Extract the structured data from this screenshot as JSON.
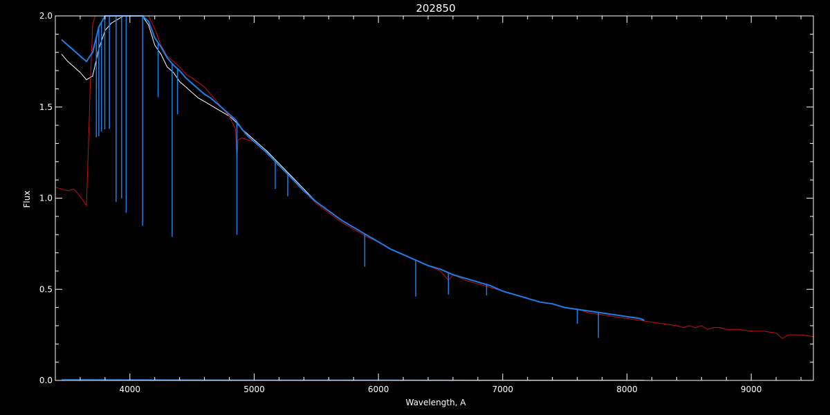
{
  "chart_data": {
    "type": "line",
    "title": "202850",
    "xlabel": "Wavelength, A",
    "ylabel": "Flux",
    "xlim": [
      3400,
      9500
    ],
    "ylim": [
      0.0,
      2.0
    ],
    "x_ticks": [
      4000,
      5000,
      6000,
      7000,
      8000,
      9000
    ],
    "x_tick_labels": [
      "4000",
      "5000",
      "6000",
      "7000",
      "8000",
      "9000"
    ],
    "y_ticks": [
      0.0,
      0.5,
      1.0,
      1.5,
      2.0
    ],
    "y_tick_labels": [
      "0.0",
      "0.5",
      "1.0",
      "1.5",
      "2.0"
    ],
    "grid": false,
    "background": "#000000",
    "series": [
      {
        "color": "#ffffff",
        "x": [
          3450,
          3500,
          3550,
          3600,
          3650,
          3700,
          3750,
          3800,
          3850,
          3900,
          3950,
          4000,
          4050,
          4100,
          4150,
          4200,
          4250,
          4300,
          4350,
          4400,
          4450,
          4500,
          4550,
          4600,
          4650,
          4700,
          4750,
          4800,
          4850,
          4900,
          4950,
          5000,
          5100,
          5200,
          5300,
          5400,
          5500,
          5600,
          5700,
          5800,
          5900,
          6000,
          6100,
          6200,
          6300,
          6400,
          6500,
          6600,
          6700,
          6800,
          6900,
          7000,
          7100,
          7200,
          7300,
          7400,
          7500,
          7600,
          7700,
          7800,
          7900,
          8000,
          8100,
          8140
        ],
        "y": [
          1.79,
          1.75,
          1.72,
          1.69,
          1.65,
          1.67,
          1.82,
          1.92,
          1.96,
          1.98,
          2.0,
          2.0,
          2.0,
          2.0,
          1.95,
          1.84,
          1.79,
          1.72,
          1.69,
          1.64,
          1.61,
          1.58,
          1.55,
          1.53,
          1.51,
          1.49,
          1.47,
          1.45,
          1.42,
          1.38,
          1.35,
          1.32,
          1.26,
          1.19,
          1.12,
          1.05,
          0.98,
          0.93,
          0.88,
          0.84,
          0.8,
          0.76,
          0.72,
          0.69,
          0.66,
          0.63,
          0.61,
          0.58,
          0.56,
          0.54,
          0.52,
          0.49,
          0.47,
          0.45,
          0.43,
          0.42,
          0.4,
          0.39,
          0.38,
          0.37,
          0.36,
          0.35,
          0.34,
          0.33
        ]
      },
      {
        "color": "#cc1010",
        "x": [
          3400,
          3450,
          3500,
          3550,
          3600,
          3630,
          3650,
          3660,
          3680,
          3700,
          3720,
          3750,
          3800,
          3850,
          3900,
          3950,
          4000,
          4050,
          4100,
          4150,
          4200,
          4250,
          4300,
          4350,
          4400,
          4450,
          4500,
          4600,
          4700,
          4800,
          4850,
          4861,
          4870,
          4900,
          5000,
          5100,
          5200,
          5300,
          5400,
          5500,
          5600,
          5700,
          5800,
          5900,
          6000,
          6100,
          6200,
          6300,
          6400,
          6500,
          6563,
          6600,
          6700,
          6800,
          6900,
          7000,
          7100,
          7200,
          7300,
          7400,
          7500,
          7600,
          7700,
          7800,
          7900,
          8000,
          8100,
          8200,
          8300,
          8400,
          8450,
          8500,
          8550,
          8600,
          8650,
          8700,
          8750,
          8800,
          8900,
          9000,
          9100,
          9200,
          9250,
          9300,
          9400,
          9500
        ],
        "y": [
          1.06,
          1.05,
          1.04,
          1.05,
          1.01,
          0.98,
          0.96,
          1.15,
          1.6,
          1.95,
          2.0,
          2.0,
          2.0,
          2.0,
          2.0,
          2.0,
          2.0,
          2.0,
          2.0,
          2.0,
          1.93,
          1.84,
          1.78,
          1.75,
          1.72,
          1.68,
          1.66,
          1.61,
          1.53,
          1.45,
          1.38,
          1.2,
          1.32,
          1.33,
          1.31,
          1.25,
          1.18,
          1.11,
          1.04,
          0.97,
          0.92,
          0.87,
          0.83,
          0.79,
          0.76,
          0.72,
          0.69,
          0.66,
          0.63,
          0.6,
          0.55,
          0.58,
          0.55,
          0.53,
          0.51,
          0.49,
          0.47,
          0.45,
          0.43,
          0.42,
          0.4,
          0.39,
          0.37,
          0.36,
          0.35,
          0.34,
          0.33,
          0.32,
          0.31,
          0.3,
          0.29,
          0.3,
          0.29,
          0.3,
          0.28,
          0.29,
          0.29,
          0.28,
          0.28,
          0.27,
          0.27,
          0.26,
          0.23,
          0.25,
          0.25,
          0.24
        ]
      },
      {
        "color": "#1e7fe8",
        "x": [
          3450,
          3500,
          3550,
          3600,
          3650,
          3700,
          3750,
          3800,
          3850,
          3900,
          3950,
          4000,
          4050,
          4100,
          4150,
          4200,
          4250,
          4300,
          4350,
          4400,
          4450,
          4500,
          4550,
          4600,
          4650,
          4700,
          4750,
          4800,
          4850,
          4900,
          4950,
          5000,
          5100,
          5200,
          5300,
          5400,
          5500,
          5600,
          5700,
          5800,
          5900,
          6000,
          6100,
          6200,
          6300,
          6400,
          6500,
          6600,
          6700,
          6800,
          6900,
          7000,
          7100,
          7200,
          7300,
          7400,
          7500,
          7600,
          7700,
          7800,
          7900,
          8000,
          8100,
          8140
        ],
        "y": [
          1.87,
          1.84,
          1.81,
          1.78,
          1.75,
          1.8,
          1.94,
          2.0,
          2.0,
          2.0,
          2.0,
          2.0,
          2.0,
          2.0,
          1.97,
          1.88,
          1.83,
          1.77,
          1.73,
          1.7,
          1.66,
          1.63,
          1.6,
          1.57,
          1.55,
          1.52,
          1.49,
          1.46,
          1.43,
          1.38,
          1.34,
          1.31,
          1.25,
          1.18,
          1.11,
          1.04,
          0.98,
          0.93,
          0.88,
          0.84,
          0.8,
          0.76,
          0.72,
          0.69,
          0.66,
          0.63,
          0.61,
          0.58,
          0.56,
          0.54,
          0.52,
          0.49,
          0.47,
          0.45,
          0.43,
          0.42,
          0.4,
          0.39,
          0.38,
          0.37,
          0.36,
          0.35,
          0.34,
          0.33
        ]
      },
      {
        "color": "#1e7fe8",
        "x": [
          3450,
          4000,
          5000,
          6000,
          7000,
          8000,
          8140
        ],
        "y": [
          0.005,
          0.004,
          0.003,
          0.003,
          0.002,
          0.002,
          0.002
        ]
      }
    ],
    "absorption_lines": [
      {
        "series": 2,
        "x": 3730,
        "depth": 0.55
      },
      {
        "series": 2,
        "x": 3750,
        "depth": 0.6
      },
      {
        "series": 2,
        "x": 3771,
        "depth": 0.6
      },
      {
        "series": 2,
        "x": 3798,
        "depth": 0.62
      },
      {
        "series": 2,
        "x": 3835,
        "depth": 0.62
      },
      {
        "series": 2,
        "x": 3889,
        "depth": 1.02
      },
      {
        "series": 2,
        "x": 3933,
        "depth": 1.0
      },
      {
        "series": 2,
        "x": 3970,
        "depth": 1.08
      },
      {
        "series": 2,
        "x": 4102,
        "depth": 1.15
      },
      {
        "series": 2,
        "x": 4227,
        "depth": 0.3
      },
      {
        "series": 2,
        "x": 4340,
        "depth": 0.95
      },
      {
        "series": 2,
        "x": 4383,
        "depth": 0.25
      },
      {
        "series": 2,
        "x": 4861,
        "depth": 0.62
      },
      {
        "series": 2,
        "x": 5170,
        "depth": 0.15
      },
      {
        "series": 2,
        "x": 5270,
        "depth": 0.12
      },
      {
        "series": 2,
        "x": 5890,
        "depth": 0.18
      },
      {
        "series": 2,
        "x": 6300,
        "depth": 0.2
      },
      {
        "series": 2,
        "x": 6563,
        "depth": 0.12
      },
      {
        "series": 2,
        "x": 6870,
        "depth": 0.06
      },
      {
        "series": 2,
        "x": 7600,
        "depth": 0.08
      },
      {
        "series": 2,
        "x": 7770,
        "depth": 0.14
      }
    ]
  }
}
